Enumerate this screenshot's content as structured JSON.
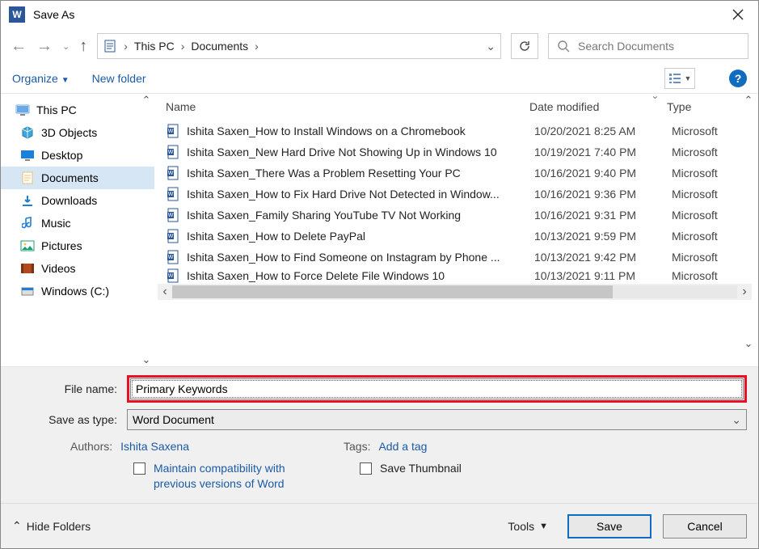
{
  "window": {
    "title": "Save As"
  },
  "breadcrumb": {
    "seg1": "This PC",
    "seg2": "Documents",
    "chevron": "›"
  },
  "search": {
    "placeholder": "Search Documents"
  },
  "toolbar": {
    "organize": "Organize",
    "newfolder": "New folder"
  },
  "sidebar": {
    "items": [
      {
        "label": "This PC",
        "color": "#6aa9e6"
      },
      {
        "label": "3D Objects",
        "color": "#3ea6d6"
      },
      {
        "label": "Desktop",
        "color": "#1d7fd6"
      },
      {
        "label": "Documents",
        "color": "#eac26b"
      },
      {
        "label": "Downloads",
        "color": "#1d7fd6"
      },
      {
        "label": "Music",
        "color": "#1d7fd6"
      },
      {
        "label": "Pictures",
        "color": "#13a06a"
      },
      {
        "label": "Videos",
        "color": "#b04a1e"
      },
      {
        "label": "Windows (C:)",
        "color": "#1d7fd6"
      }
    ]
  },
  "columns": {
    "name": "Name",
    "date": "Date modified",
    "type": "Type"
  },
  "files": [
    {
      "name": "Ishita Saxen_How to Install Windows on a Chromebook",
      "date": "10/20/2021 8:25 AM",
      "type": "Microsoft"
    },
    {
      "name": "Ishita Saxen_New Hard Drive Not Showing Up in Windows 10",
      "date": "10/19/2021 7:40 PM",
      "type": "Microsoft"
    },
    {
      "name": "Ishita Saxen_There Was a Problem Resetting Your PC",
      "date": "10/16/2021 9:40 PM",
      "type": "Microsoft"
    },
    {
      "name": "Ishita Saxen_How to Fix Hard Drive Not Detected in Window...",
      "date": "10/16/2021 9:36 PM",
      "type": "Microsoft"
    },
    {
      "name": "Ishita Saxen_Family Sharing YouTube TV Not Working",
      "date": "10/16/2021 9:31 PM",
      "type": "Microsoft"
    },
    {
      "name": "Ishita Saxen_How to Delete PayPal",
      "date": "10/13/2021 9:59 PM",
      "type": "Microsoft"
    },
    {
      "name": "Ishita Saxen_How to Find Someone on Instagram by Phone ...",
      "date": "10/13/2021 9:42 PM",
      "type": "Microsoft"
    },
    {
      "name": "Ishita Saxen_How to Force Delete File Windows 10",
      "date": "10/13/2021 9:11 PM",
      "type": "Microsoft"
    }
  ],
  "form": {
    "filename_label": "File name:",
    "filename_value": "Primary Keywords",
    "savetype_label": "Save as type:",
    "savetype_value": "Word Document",
    "authors_label": "Authors:",
    "authors_value": "Ishita Saxena",
    "tags_label": "Tags:",
    "tags_value": "Add a tag",
    "maintain_label": "Maintain compatibility with previous versions of Word",
    "thumbnail_label": "Save Thumbnail"
  },
  "footer": {
    "hide": "Hide Folders",
    "tools": "Tools",
    "save": "Save",
    "cancel": "Cancel"
  }
}
